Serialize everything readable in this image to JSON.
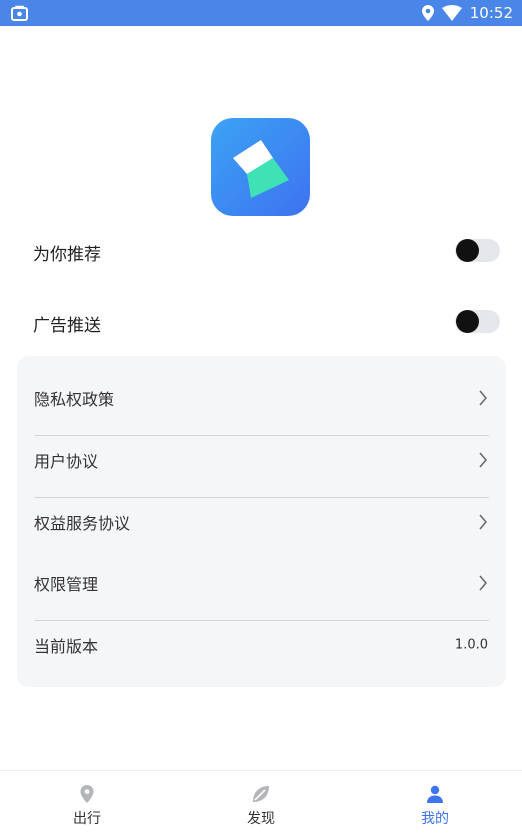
{
  "status_bar": {
    "time": "10:52"
  },
  "toggles": [
    {
      "label": "为你推荐",
      "enabled": false
    },
    {
      "label": "广告推送",
      "enabled": false
    }
  ],
  "menu": {
    "items": [
      {
        "label": "隐私权政策"
      },
      {
        "label": "用户协议"
      },
      {
        "label": "权益服务协议"
      },
      {
        "label": "权限管理"
      }
    ],
    "version": {
      "label": "当前版本",
      "value": "1.0.0"
    }
  },
  "tabs": [
    {
      "label": "出行",
      "icon": "location-pin-icon",
      "active": false
    },
    {
      "label": "发现",
      "icon": "discover-leaf-icon",
      "active": false
    },
    {
      "label": "我的",
      "icon": "profile-user-icon",
      "active": true
    }
  ],
  "colors": {
    "status_bar": "#4a86e8",
    "accent": "#3d74f0",
    "card_bg": "#f5f6f8"
  }
}
